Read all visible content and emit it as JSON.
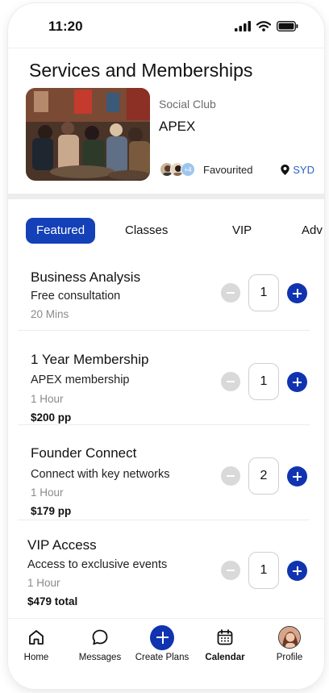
{
  "status_bar": {
    "time": "11:20"
  },
  "page": {
    "title": "Services and Memberships"
  },
  "venue": {
    "category": "Social Club",
    "name": "APEX",
    "favourited_extra": "+4",
    "favourited_label": "Favourited",
    "location": "SYD"
  },
  "tabs": [
    {
      "label": "Featured",
      "active": true
    },
    {
      "label": "Classes",
      "active": false
    },
    {
      "label": "VIP",
      "active": false
    },
    {
      "label": "Adv",
      "active": false
    }
  ],
  "services": [
    {
      "title": "Business Analysis",
      "subtitle": "Free consultation",
      "duration": "20 Mins",
      "price": "",
      "quantity": "1"
    },
    {
      "title": "1 Year Membership",
      "subtitle": "APEX membership",
      "duration": "1 Hour",
      "price": "$200 pp",
      "quantity": "1"
    },
    {
      "title": "Founder Connect",
      "subtitle": "Connect with key networks",
      "duration": "1 Hour",
      "price": "$179 pp",
      "quantity": "2"
    },
    {
      "title": "VIP Access",
      "subtitle": "Access to exclusive events",
      "duration": "1 Hour",
      "price": "$479 total",
      "quantity": "1"
    }
  ],
  "bottom_nav": [
    {
      "label": "Home",
      "icon": "home-icon"
    },
    {
      "label": "Messages",
      "icon": "chat-bubble-icon"
    },
    {
      "label": "Create Plans",
      "icon": "plus-icon"
    },
    {
      "label": "Calendar",
      "icon": "calendar-icon"
    },
    {
      "label": "Profile",
      "icon": "profile-avatar"
    }
  ],
  "colors": {
    "accent": "#1033b0",
    "tab_active": "#1440b8",
    "location": "#2a62c9"
  }
}
